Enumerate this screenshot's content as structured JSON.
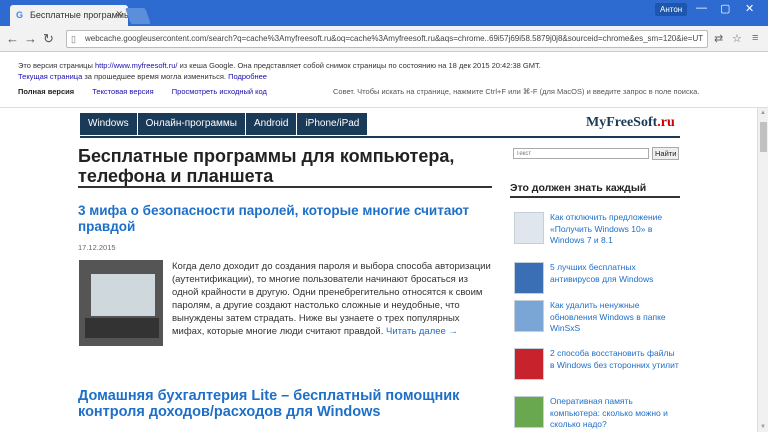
{
  "browser": {
    "tab_title": "Бесплатные программы ...",
    "tab_icon": "G",
    "user_name": "Антон",
    "address": "webcache.googleusercontent.com/search?q=cache%3Amyfreesoft.ru&oq=cache%3Amyfreesoft.ru&aqs=chrome..69i57j69i58.5879j0j8&sourceid=chrome&es_sm=120&ie=UT"
  },
  "cache": {
    "line1_prefix": "Это версия страницы",
    "line1_link": "http://www.myfreesoft.ru/",
    "line1_suffix": "из кеша Google. Она представляет собой снимок страницы по состоянию на 18 дек 2015 20:42:38 GMT.",
    "line2_link": "Текущая страница",
    "line2_mid": "за прошедшее время могла измениться.",
    "line2_more": "Подробнее",
    "full_version": "Полная версия",
    "text_version": "Текстовая версия",
    "view_source": "Просмотреть исходный код",
    "tip": "Совет. Чтобы искать на странице, нажмите Ctrl+F или ⌘-F (для MacOS) и введите запрос в поле поиска."
  },
  "site": {
    "menu": [
      "Windows",
      "Онлайн-программы",
      "Android",
      "iPhone/iPad"
    ],
    "logo_main": "MyFreeSoft",
    "logo_tld": ".ru",
    "heading": "Бесплатные программы для компьютера, телефона и планшета",
    "search_placeholder": "Текст",
    "search_button": "Найти"
  },
  "article1": {
    "title": "3 мифа о безопасности паролей, которые многие считают правдой",
    "date": "17.12.2015",
    "excerpt": "Когда дело доходит до создания пароля и выбора способа авторизации (аутентификации), то многие пользователи начинают бросаться из одной крайности в другую. Одни пренебрегительно относятся к своим паролям, а другие создают настолько сложные и неудобные, что вынуждены затем страдать. Ниже вы узнаете о трех популярных мифах, которые многие люди считают правдой.",
    "read_more": "Читать далее →"
  },
  "article2": {
    "title": "Домашняя бухгалтерия Lite – бесплатный помощник контроля доходов/расходов для Windows"
  },
  "sidebar": {
    "title": "Это должен знать каждый",
    "items": [
      {
        "label": "Как отключить предложение «Получить Windows 10» в Windows 7 и 8.1"
      },
      {
        "label": "5 лучших бесплатных антивирусов для Windows"
      },
      {
        "label": "Как удалить ненужные обновления Windows в папке WinSxS"
      },
      {
        "label": "2 способа восстановить файлы в Windows без сторонних утилит"
      },
      {
        "label": "Оперативная память компьютера: сколько можно и сколько надо?"
      }
    ]
  }
}
